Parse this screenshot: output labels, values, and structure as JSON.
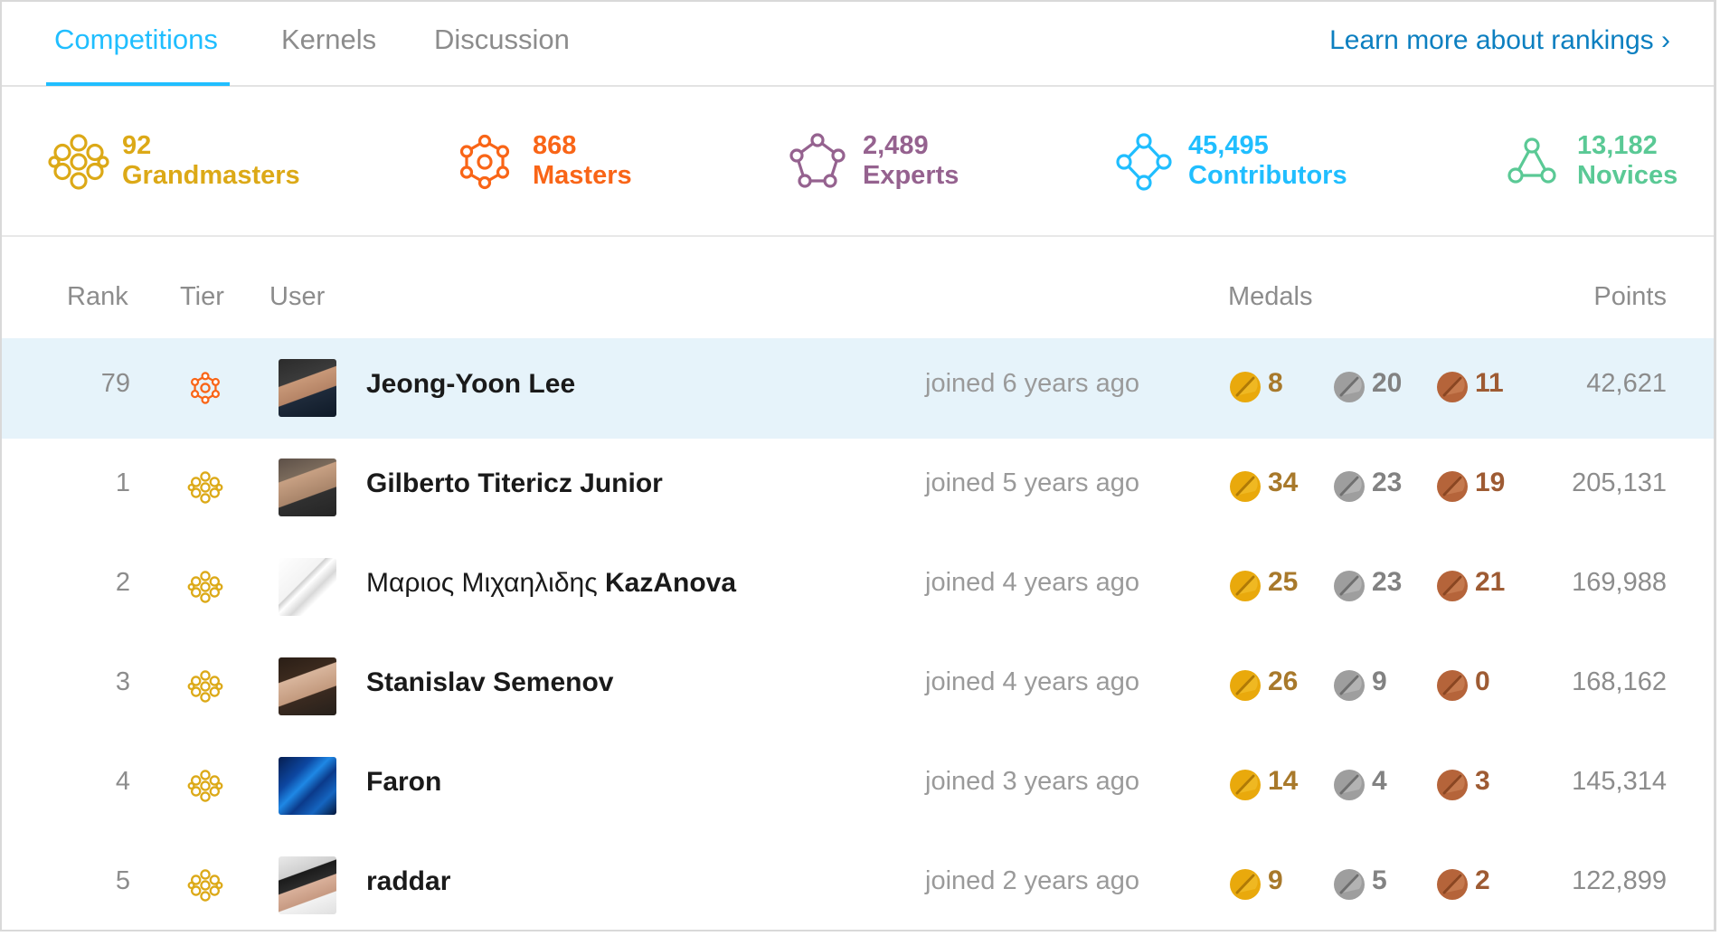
{
  "tabs": [
    {
      "label": "Competitions",
      "active": true
    },
    {
      "label": "Kernels",
      "active": false
    },
    {
      "label": "Discussion",
      "active": false
    }
  ],
  "learn_more": "Learn more about rankings ›",
  "tiers": [
    {
      "count": "92",
      "label": "Grandmasters",
      "color": "#dca917",
      "icon": "grandmaster-icon"
    },
    {
      "count": "868",
      "label": "Masters",
      "color": "#f96517",
      "icon": "master-icon"
    },
    {
      "count": "2,489",
      "label": "Experts",
      "color": "#95628f",
      "icon": "expert-icon"
    },
    {
      "count": "45,495",
      "label": "Contributors",
      "color": "#20beff",
      "icon": "contributor-icon"
    },
    {
      "count": "13,182",
      "label": "Novices",
      "color": "#5ac995",
      "icon": "novice-icon"
    }
  ],
  "table": {
    "headers": {
      "rank": "Rank",
      "tier": "Tier",
      "user": "User",
      "medals": "Medals",
      "points": "Points"
    },
    "rows": [
      {
        "rank": "79",
        "tier": "master",
        "name": "Jeong-Yoon Lee",
        "name_light": "",
        "joined": "joined 6 years ago",
        "gold": "8",
        "silver": "20",
        "bronze": "11",
        "points": "42,621",
        "highlight": true
      },
      {
        "rank": "1",
        "tier": "grandmaster",
        "name": "Gilberto Titericz Junior",
        "name_light": "",
        "joined": "joined 5 years ago",
        "gold": "34",
        "silver": "23",
        "bronze": "19",
        "points": "205,131",
        "highlight": false
      },
      {
        "rank": "2",
        "tier": "grandmaster",
        "name": "KazAnova",
        "name_light": "Μαριος Μιχαηλιδης ",
        "joined": "joined 4 years ago",
        "gold": "25",
        "silver": "23",
        "bronze": "21",
        "points": "169,988",
        "highlight": false
      },
      {
        "rank": "3",
        "tier": "grandmaster",
        "name": "Stanislav Semenov",
        "name_light": "",
        "joined": "joined 4 years ago",
        "gold": "26",
        "silver": "9",
        "bronze": "0",
        "points": "168,162",
        "highlight": false
      },
      {
        "rank": "4",
        "tier": "grandmaster",
        "name": "Faron",
        "name_light": "",
        "joined": "joined 3 years ago",
        "gold": "14",
        "silver": "4",
        "bronze": "3",
        "points": "145,314",
        "highlight": false
      },
      {
        "rank": "5",
        "tier": "grandmaster",
        "name": "raddar",
        "name_light": "",
        "joined": "joined 2 years ago",
        "gold": "9",
        "silver": "5",
        "bronze": "2",
        "points": "122,899",
        "highlight": false
      }
    ]
  },
  "colors": {
    "accent": "#20beff",
    "link": "#0c7fc0",
    "highlight_row": "#e6f3fa",
    "gold_medal": "#e9a90c",
    "silver_medal": "#9e9e9e",
    "bronze_medal": "#b5643a"
  }
}
